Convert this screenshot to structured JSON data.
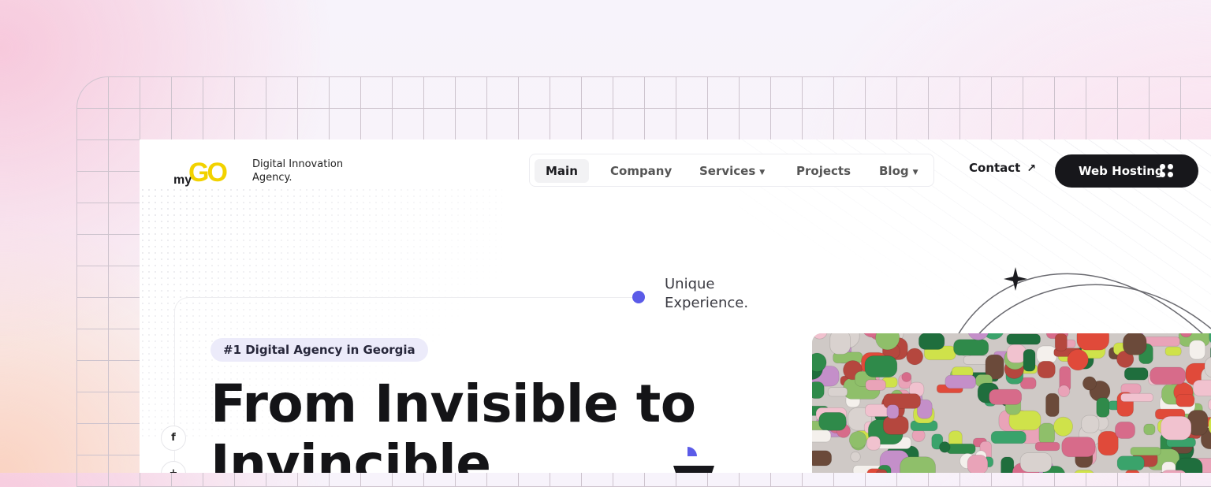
{
  "brand": {
    "logo_prefix": "my",
    "logo_main": "GO",
    "tagline_line1": "Digital Innovation",
    "tagline_line2": "Agency."
  },
  "nav": {
    "items": [
      {
        "label": "Main",
        "active": true
      },
      {
        "label": "Company"
      },
      {
        "label": "Services",
        "dropdown": true
      },
      {
        "label": "Projects"
      },
      {
        "label": "Blog",
        "dropdown": true
      }
    ]
  },
  "header": {
    "contact_label": "Contact",
    "contact_icon": "arrow-up-right-icon",
    "hosting_label": "Web Hosting",
    "hosting_icon": "grid-dots-icon"
  },
  "hero": {
    "annotation_line1": "Unique",
    "annotation_line2": "Experience.",
    "badge": "#1 Digital Agency in Georgia",
    "title_line1": "From Invisible to",
    "title_line2": "Invincible"
  },
  "social": {
    "facebook_glyph": "f",
    "second_glyph": "+"
  },
  "colors": {
    "logo_yellow": "#f2d200",
    "accent_purple": "#5b5be8",
    "dark": "#17171b",
    "badge_bg": "#ecebfa"
  }
}
